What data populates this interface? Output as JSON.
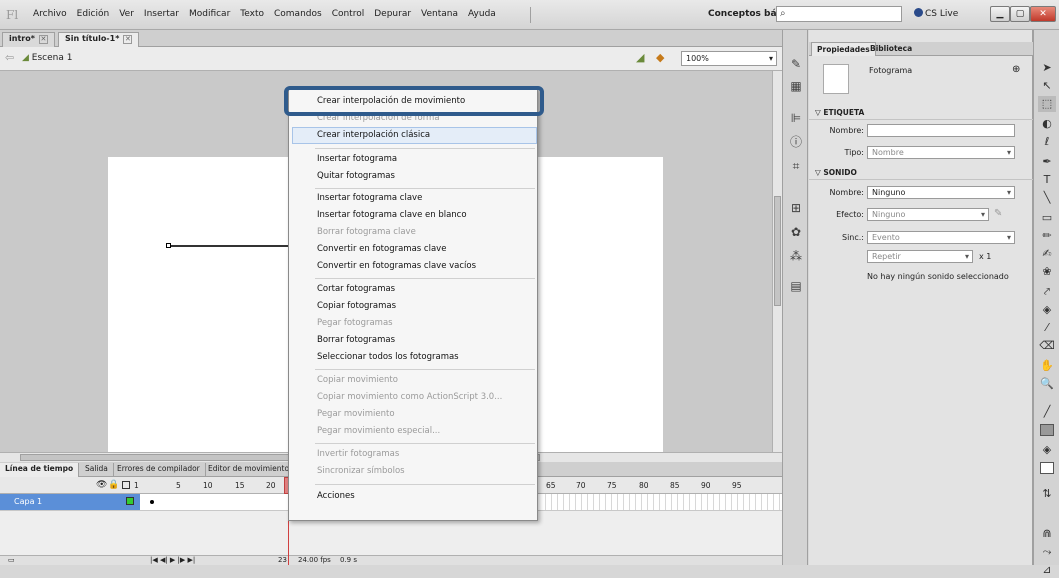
{
  "app": {
    "logo": "Fl",
    "workspace": "Conceptos básicos ▾",
    "cs_live": "CS Live"
  },
  "menubar": [
    "Archivo",
    "Edición",
    "Ver",
    "Insertar",
    "Modificar",
    "Texto",
    "Comandos",
    "Control",
    "Depurar",
    "Ventana",
    "Ayuda"
  ],
  "doc_tabs": [
    {
      "label": "intro*"
    },
    {
      "label": "Sin título-1*"
    }
  ],
  "scene": "Escena 1",
  "zoom": "100%",
  "timeline": {
    "tabs": [
      "Línea de tiempo",
      "Salida",
      "Errores de compilador",
      "Editor de movimiento"
    ],
    "layer_name": "Capa 1",
    "frame_numbers_left": [
      "1",
      "5",
      "10",
      "15",
      "20"
    ],
    "frame_numbers_right": [
      "65",
      "70",
      "75",
      "80",
      "85",
      "90",
      "95"
    ],
    "footer": {
      "frame": "23",
      "fps": "24.00 fps",
      "time": "0.9 s"
    }
  },
  "properties": {
    "tabs": [
      "Propiedades",
      "Biblioteca"
    ],
    "type": "Fotograma",
    "etiqueta": {
      "header": "ETIQUETA",
      "nombre_label": "Nombre:",
      "nombre_value": "",
      "tipo_label": "Tipo:",
      "tipo_value": "Nombre"
    },
    "sonido": {
      "header": "SONIDO",
      "nombre_label": "Nombre:",
      "nombre_value": "Ninguno",
      "efecto_label": "Efecto:",
      "efecto_value": "Ninguno",
      "sinc_label": "Sinc.:",
      "sinc_value": "Evento",
      "repetir_value": "Repetir",
      "repeat_count": "x 1",
      "status": "No hay ningún sonido seleccionado"
    }
  },
  "context_menu": [
    {
      "label": "Crear interpolación de movimiento",
      "enabled": true
    },
    {
      "label": "Crear interpolación de forma",
      "enabled": false
    },
    {
      "label": "Crear interpolación clásica",
      "enabled": true
    },
    {
      "label": "Insertar fotograma",
      "enabled": true
    },
    {
      "label": "Quitar fotogramas",
      "enabled": true
    },
    {
      "label": "Insertar fotograma clave",
      "enabled": true
    },
    {
      "label": "Insertar fotograma clave en blanco",
      "enabled": true
    },
    {
      "label": "Borrar fotograma clave",
      "enabled": false
    },
    {
      "label": "Convertir en fotogramas clave",
      "enabled": true
    },
    {
      "label": "Convertir en fotogramas clave vacíos",
      "enabled": true
    },
    {
      "label": "Cortar fotogramas",
      "enabled": true
    },
    {
      "label": "Copiar fotogramas",
      "enabled": true
    },
    {
      "label": "Pegar fotogramas",
      "enabled": false
    },
    {
      "label": "Borrar fotogramas",
      "enabled": true
    },
    {
      "label": "Seleccionar todos los fotogramas",
      "enabled": true
    },
    {
      "label": "Copiar movimiento",
      "enabled": false
    },
    {
      "label": "Copiar movimiento como ActionScript 3.0...",
      "enabled": false
    },
    {
      "label": "Pegar movimiento",
      "enabled": false
    },
    {
      "label": "Pegar movimiento especial...",
      "enabled": false
    },
    {
      "label": "Invertir fotogramas",
      "enabled": false
    },
    {
      "label": "Sincronizar símbolos",
      "enabled": false
    },
    {
      "label": "Acciones",
      "enabled": true
    }
  ],
  "colors": {
    "highlight_border": "#2f5b8c",
    "layer_selected": "#5b8fd8",
    "playhead": "#d04040"
  }
}
